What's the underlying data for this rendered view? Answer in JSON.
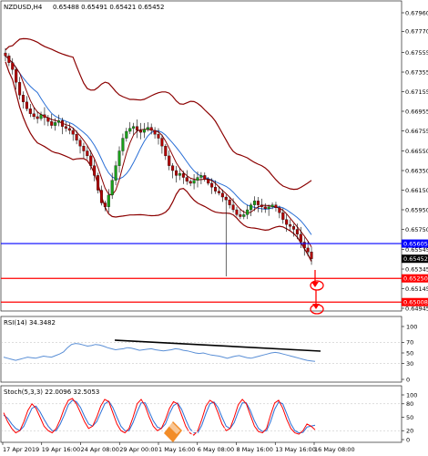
{
  "header": {
    "symbol": "NZDUSD,H4",
    "ohlc": "0.65488 0.65491 0.65421 0.65452"
  },
  "watermark": "instaforex",
  "colors": {
    "bull": "#1a9e1a",
    "bear": "#b00000",
    "ma_blue": "#2a6fd6",
    "band_dark": "#8b0000",
    "level_blue": "#0000ff",
    "level_red": "#ff0000",
    "label_blue_bg": "#0000ff",
    "label_red_bg": "#ff0000",
    "label_black_bg": "#000000",
    "rsi_line": "#5a8fd6",
    "stoch_main": "#ff0000",
    "stoch_signal": "#2a6fd6",
    "trendline": "#000000"
  },
  "chart_data": [
    {
      "type": "candlestick",
      "title": "NZDUSD,H4",
      "ylim": [
        0.64945,
        0.6796
      ],
      "y_ticks": [
        "0.67960",
        "0.67770",
        "0.67555",
        "0.67355",
        "0.67155",
        "0.66955",
        "0.66755",
        "0.66550",
        "0.66350",
        "0.66150",
        "0.65950",
        "0.65750",
        "0.65545",
        "0.65345",
        "0.65145",
        "0.64945"
      ],
      "x_ticks": [
        "17 Apr 2019",
        "19 Apr 16:00",
        "24 Apr 08:00",
        "29 Apr 00:00",
        "1 May 16:00",
        "6 May 08:00",
        "8 May 16:00",
        "13 May 16:00",
        "16 May 08:00"
      ],
      "price_path": [
        0.6752,
        0.6745,
        0.6738,
        0.6725,
        0.6712,
        0.6705,
        0.6698,
        0.6693,
        0.669,
        0.6688,
        0.6692,
        0.6689,
        0.6685,
        0.6681,
        0.6684,
        0.6686,
        0.668,
        0.6678,
        0.6676,
        0.6672,
        0.6666,
        0.666,
        0.6655,
        0.665,
        0.664,
        0.663,
        0.6615,
        0.6602,
        0.6598,
        0.661,
        0.6625,
        0.664,
        0.6655,
        0.6668,
        0.6675,
        0.6678,
        0.668,
        0.6676,
        0.6674,
        0.6677,
        0.6679,
        0.6676,
        0.6672,
        0.6668,
        0.666,
        0.665,
        0.664,
        0.6635,
        0.663,
        0.6632,
        0.6628,
        0.6624,
        0.6622,
        0.6625,
        0.6628,
        0.663,
        0.6626,
        0.6622,
        0.6618,
        0.6614,
        0.6612,
        0.6608,
        0.6605,
        0.66,
        0.6595,
        0.659,
        0.6588,
        0.659,
        0.6595,
        0.66,
        0.6604,
        0.66,
        0.6598,
        0.6596,
        0.6598,
        0.66,
        0.6597,
        0.6592,
        0.6585,
        0.658,
        0.6578,
        0.6575,
        0.657,
        0.6562,
        0.6556,
        0.6552,
        0.6545
      ],
      "levels": [
        {
          "value": 0.65605,
          "label": "0.65605",
          "color": "#0000ff"
        },
        {
          "value": 0.6525,
          "label": "0.65250",
          "color": "#ff0000"
        },
        {
          "value": 0.65008,
          "label": "0.65008",
          "color": "#ff0000"
        }
      ],
      "current_price_label": "0.65452"
    },
    {
      "type": "line",
      "title": "RSI(14) 34.3482",
      "ylim": [
        0,
        100
      ],
      "y_ticks": [
        "100",
        "70",
        "50",
        "30",
        "0"
      ],
      "values": [
        42,
        40,
        38,
        36,
        38,
        40,
        42,
        41,
        40,
        42,
        44,
        43,
        42,
        45,
        48,
        52,
        60,
        66,
        68,
        67,
        65,
        63,
        64,
        66,
        65,
        63,
        60,
        58,
        56,
        57,
        58,
        60,
        59,
        57,
        55,
        56,
        57,
        58,
        56,
        55,
        54,
        55,
        56,
        58,
        57,
        55,
        54,
        52,
        50,
        49,
        50,
        48,
        46,
        45,
        44,
        42,
        40,
        42,
        44,
        45,
        43,
        41,
        40,
        42,
        44,
        46,
        48,
        50,
        51,
        50,
        48,
        46,
        44,
        42,
        40,
        38,
        36,
        35,
        34
      ]
    },
    {
      "type": "line",
      "title": "Stoch(5,3,3) 22.0096 32.5053",
      "ylim": [
        0,
        100
      ],
      "y_ticks": [
        "100",
        "80",
        "50",
        "20",
        "0"
      ],
      "series": [
        {
          "values": [
            60,
            40,
            25,
            15,
            20,
            40,
            65,
            80,
            70,
            50,
            30,
            20,
            15,
            25,
            45,
            70,
            88,
            92,
            80,
            60,
            40,
            25,
            30,
            50,
            75,
            90,
            85,
            60,
            35,
            20,
            15,
            25,
            50,
            80,
            90,
            75,
            50,
            30,
            20,
            25,
            45,
            70,
            85,
            80,
            55,
            30,
            15,
            10,
            20,
            45,
            75,
            88,
            82,
            60,
            35,
            20,
            25,
            50,
            78,
            90,
            80,
            55,
            30,
            18,
            15,
            25,
            55,
            82,
            88,
            70,
            45,
            25,
            15,
            12,
            20,
            35,
            30,
            22
          ]
        },
        {
          "values": [
            55,
            48,
            35,
            25,
            20,
            30,
            50,
            70,
            75,
            62,
            45,
            30,
            20,
            20,
            35,
            55,
            78,
            88,
            85,
            72,
            52,
            35,
            30,
            40,
            60,
            80,
            86,
            72,
            50,
            30,
            20,
            20,
            38,
            62,
            82,
            82,
            62,
            42,
            28,
            25,
            35,
            58,
            76,
            82,
            68,
            45,
            25,
            15,
            15,
            32,
            58,
            80,
            84,
            72,
            50,
            30,
            25,
            38,
            62,
            82,
            82,
            65,
            42,
            25,
            18,
            20,
            40,
            68,
            84,
            80,
            58,
            35,
            20,
            15,
            16,
            28,
            30,
            32
          ]
        }
      ]
    }
  ]
}
